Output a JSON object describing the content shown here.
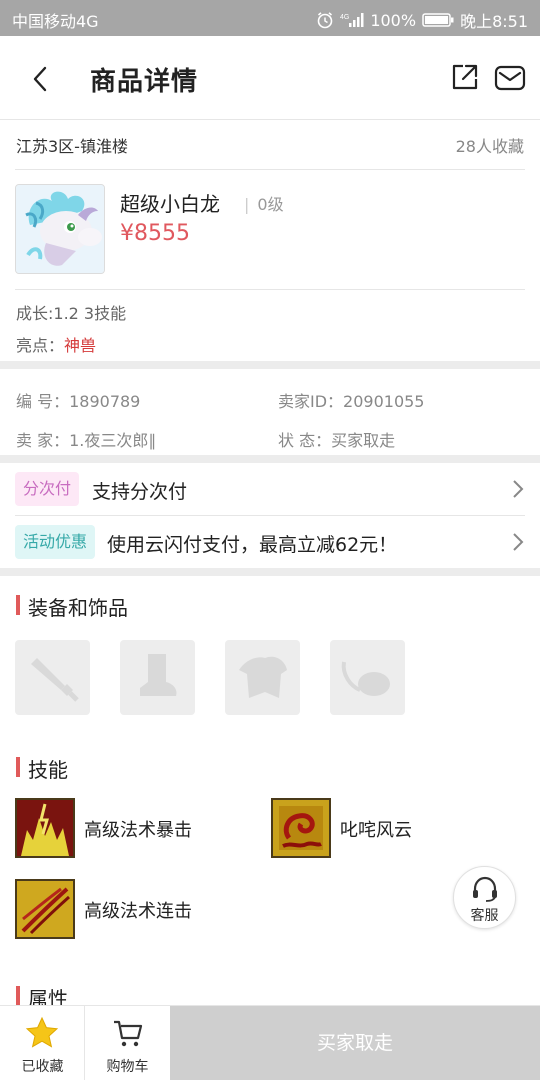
{
  "status_bar": {
    "carrier": "中国移动4G",
    "battery": "100%",
    "time": "晚上8:51"
  },
  "header": {
    "title": "商品详情",
    "back_icon": "chevron-left-icon",
    "share_icon": "share-icon",
    "message_icon": "mail-icon"
  },
  "listing": {
    "server": "江苏3区-镇淮楼",
    "favorites": "28人收藏"
  },
  "product": {
    "name": "超级小白龙",
    "level": "0级",
    "price": "¥8555",
    "growth": "成长:1.2 3技能",
    "highlight_label": "亮点：",
    "highlight_value": "神兽"
  },
  "details": {
    "id_label": "编  号：",
    "id_value": "1890789",
    "seller_id_label": "卖家ID：",
    "seller_id_value": "20901055",
    "seller_label": "卖  家：",
    "seller_value": "1.夜三次郎∥",
    "status_label": "状  态：",
    "status_value": "买家取走"
  },
  "promos": [
    {
      "badge": "分次付",
      "text": "支持分次付"
    },
    {
      "badge": "活动优惠",
      "text": "使用云闪付支付，最高立减62元！"
    }
  ],
  "equipment": {
    "title": "装备和饰品",
    "slots": [
      "weapon-slot-icon",
      "boots-slot-icon",
      "armor-slot-icon",
      "accessory-slot-icon"
    ]
  },
  "skills": {
    "title": "技能",
    "items": [
      {
        "name": "高级法术暴击",
        "icon": "magic-crit-skill-icon"
      },
      {
        "name": "叱咤风云",
        "icon": "dragon-skill-icon"
      },
      {
        "name": "高级法术连击",
        "icon": "magic-combo-skill-icon"
      }
    ]
  },
  "attributes": {
    "title": "属性"
  },
  "customer_service": {
    "label": "客服"
  },
  "bottom_bar": {
    "favorited_label": "已收藏",
    "cart_label": "购物车",
    "buy_label": "买家取走"
  },
  "colors": {
    "price": "#e0585e",
    "highlight": "#d53b3b",
    "section_accent": "#e05a5a",
    "star": "#f5c518",
    "buy_button_disabled": "#cfcfcf"
  }
}
